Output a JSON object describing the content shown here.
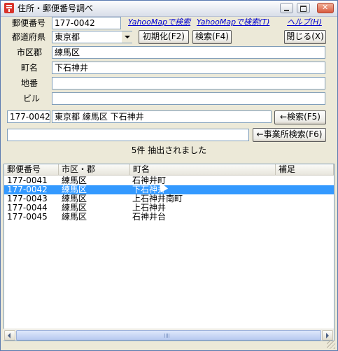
{
  "window": {
    "title": "住所・郵便番号調べ"
  },
  "labels": {
    "postal_code": "郵便番号",
    "prefecture": "都道府県",
    "city": "市区郡",
    "town": "町名",
    "block": "地番",
    "building": "ビル"
  },
  "fields": {
    "postal_code": "177-0042",
    "prefecture": "東京都",
    "city": "練馬区",
    "town": "下石神井",
    "block": "",
    "building": ""
  },
  "links": {
    "yahoo_map_search": "YahooMapで検索",
    "yahoo_map_search_t": "YahooMapで検索(T)",
    "help": "ヘルプ(H)"
  },
  "buttons": {
    "initialize": "初期化(F2)",
    "search": "検索(F4)",
    "close": "閉じる(X)",
    "reverse_search": "←検索(F5)",
    "business_search": "←事業所検索(F6)"
  },
  "result": {
    "postal_code": "177-0042",
    "address": "東京都 練馬区 下石神井",
    "business_input": ""
  },
  "status": "5件 抽出されました",
  "table": {
    "columns": [
      "郵便番号",
      "市区・郡",
      "町名",
      "補足"
    ],
    "rows": [
      [
        "177-0041",
        "練馬区",
        "石神井町",
        ""
      ],
      [
        "177-0042",
        "練馬区",
        "下石神井",
        ""
      ],
      [
        "177-0043",
        "練馬区",
        "上石神井南町",
        ""
      ],
      [
        "177-0044",
        "練馬区",
        "上石神井",
        ""
      ],
      [
        "177-0045",
        "練馬区",
        "石神井台",
        ""
      ]
    ],
    "selected_row": 2
  },
  "icons": {
    "app": "postal-app-icon",
    "minimize": "minimize-icon",
    "maximize": "maximize-icon",
    "close": "close-icon",
    "dropdown": "chevron-down-icon"
  }
}
